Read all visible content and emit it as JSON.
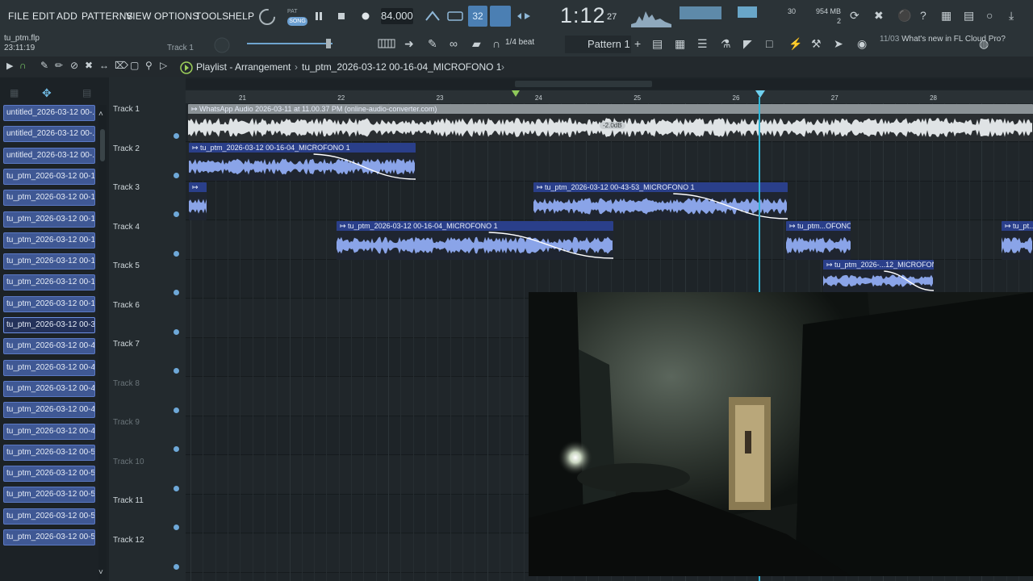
{
  "menu": {
    "file": "FILE",
    "edit": "EDIT",
    "add": "ADD",
    "patterns": "PATTERNS",
    "view": "VIEW",
    "options": "OPTIONS",
    "tools": "TOOLS",
    "help": "HELP"
  },
  "transport": {
    "pat_label": "PAT",
    "song_label": "SONG",
    "tempo": "84.000",
    "time_main": "1:12",
    "time_sub": "27",
    "rec_count": "32"
  },
  "system": {
    "memory": "954 MB",
    "cpu_count": "2",
    "meter_value": "30"
  },
  "project": {
    "filename": "tu_ptm.flp",
    "time": "23:11:19",
    "track_hint": "Track 1"
  },
  "toolbar": {
    "snap": "1/4 beat",
    "pattern": "Pattern 1",
    "news_num": "11/03",
    "news_text": "What's new in FL Cloud Pro?"
  },
  "playlist": {
    "title": "Playlist - Arrangement",
    "sep": "›",
    "pattern": "tu_ptm_2026-03-12 00-16-04_MICROFONO 1",
    "arrow": "›"
  },
  "ruler": [
    "21",
    "22",
    "23",
    "24",
    "25",
    "26",
    "27",
    "28"
  ],
  "clip_list": [
    "untitled_2026-03-12 00-...",
    "untitled_2026-03-12 00-...",
    "untitled_2026-03-12 00-...",
    "tu_ptm_2026-03-12 00-1...",
    "tu_ptm_2026-03-12 00-1...",
    "tu_ptm_2026-03-12 00-1...",
    "tu_ptm_2026-03-12 00-1...",
    "tu_ptm_2026-03-12 00-1...",
    "tu_ptm_2026-03-12 00-1...",
    "tu_ptm_2026-03-12 00-1...",
    "tu_ptm_2026-03-12 00-3...",
    "tu_ptm_2026-03-12 00-4...",
    "tu_ptm_2026-03-12 00-4...",
    "tu_ptm_2026-03-12 00-4...",
    "tu_ptm_2026-03-12 00-4...",
    "tu_ptm_2026-03-12 00-4...",
    "tu_ptm_2026-03-12 00-5...",
    "tu_ptm_2026-03-12 00-5...",
    "tu_ptm_2026-03-12 00-5...",
    "tu_ptm_2026-03-12 00-5...",
    "tu_ptm_2026-03-12 00-5..."
  ],
  "tracks": [
    {
      "label": "Track 1",
      "dim": false
    },
    {
      "label": "Track 2",
      "dim": false
    },
    {
      "label": "Track 3",
      "dim": false
    },
    {
      "label": "Track 4",
      "dim": false
    },
    {
      "label": "Track 5",
      "dim": false
    },
    {
      "label": "Track 6",
      "dim": false
    },
    {
      "label": "Track 7",
      "dim": false
    },
    {
      "label": "Track 8",
      "dim": true
    },
    {
      "label": "Track 9",
      "dim": true
    },
    {
      "label": "Track 10",
      "dim": true
    },
    {
      "label": "Track 11",
      "dim": false
    },
    {
      "label": "Track 12",
      "dim": false
    }
  ],
  "clips": [
    {
      "track": 0,
      "name": "WhatsApp Audio 2026-03-11 at 11.00.37 PM (online-audio-converter.com)",
      "style": "gray",
      "gain": "-2.0dB"
    },
    {
      "track": 1,
      "name": "tu_ptm_2026-03-12 00-16-04_MICROFONO 1",
      "style": "blue"
    },
    {
      "track": 2,
      "name": "",
      "style": "blue"
    },
    {
      "track": 2,
      "name": "tu_ptm_2026-03-12 00-43-53_MICROFONO 1",
      "style": "blue"
    },
    {
      "track": 3,
      "name": "tu_ptm_2026-03-12 00-16-04_MICROFONO 1",
      "style": "blue"
    },
    {
      "track": 3,
      "name": "tu_ptm...OFONO 1",
      "style": "blue"
    },
    {
      "track": 3,
      "name": "tu_pt...",
      "style": "blue"
    },
    {
      "track": 4,
      "name": "tu_ptm_2026-...12_MICROFONO 1",
      "style": "blue"
    }
  ],
  "colors": {
    "accent": "#2fb5d6",
    "clip_blue": "#2a3f8a",
    "wave_blue": "#8aa4e8",
    "clip_gray": "#8b9296"
  }
}
